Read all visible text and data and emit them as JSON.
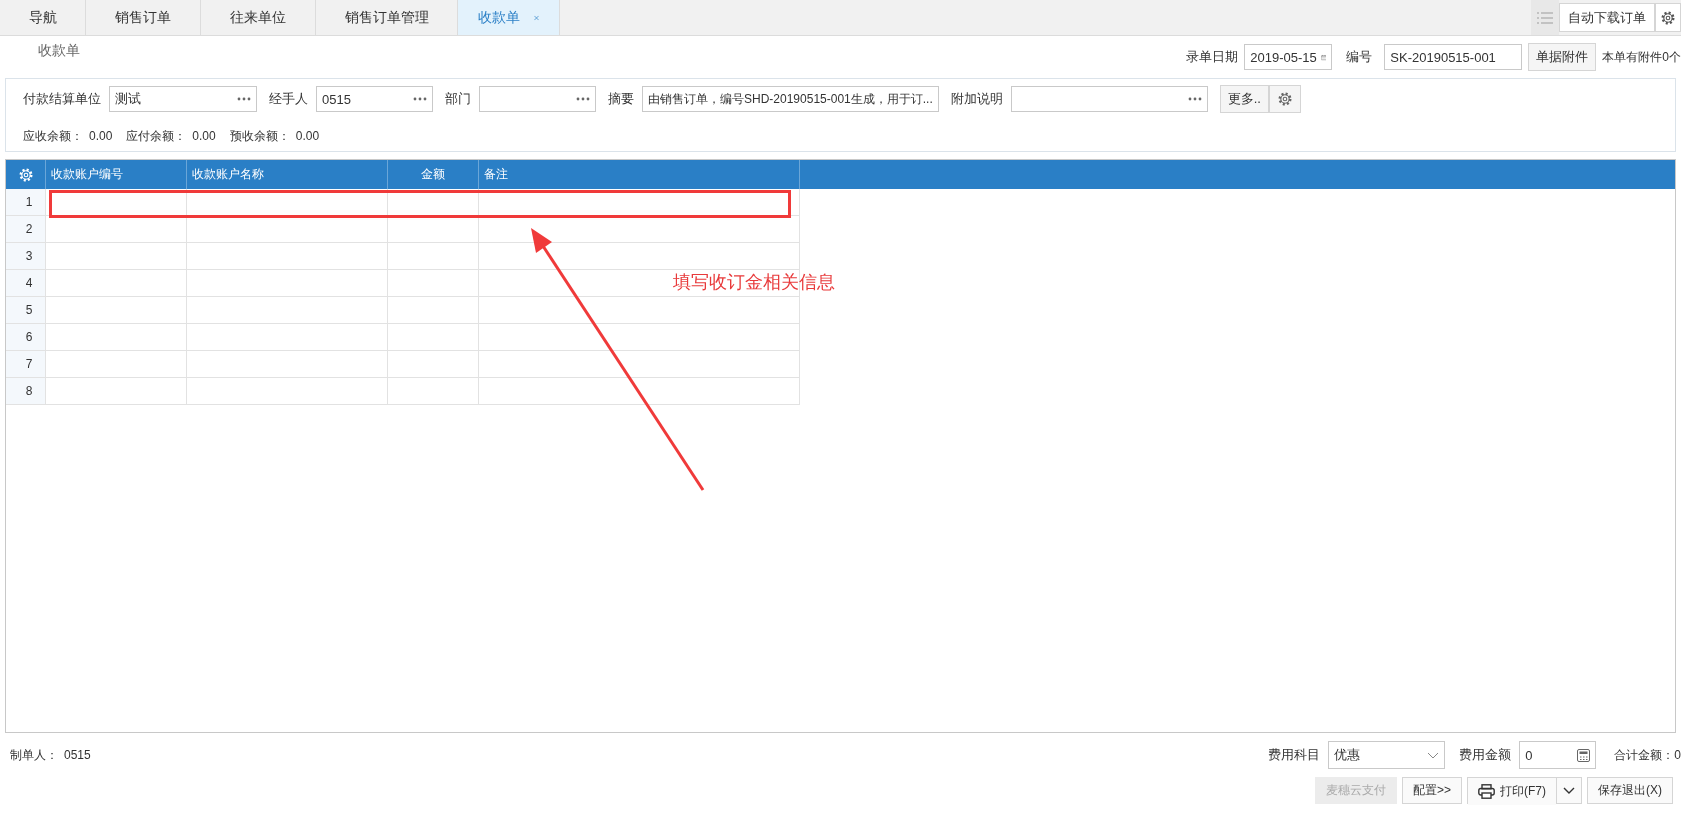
{
  "tabs": [
    {
      "label": "导航",
      "selected": false,
      "closable": false
    },
    {
      "label": "销售订单",
      "selected": false,
      "closable": false
    },
    {
      "label": "往来单位",
      "selected": false,
      "closable": false
    },
    {
      "label": "销售订单管理",
      "selected": false,
      "closable": false
    },
    {
      "label": "收款单",
      "selected": true,
      "closable": true
    }
  ],
  "toolbar": {
    "download_button": "自动下载订单"
  },
  "page_title": "收款单",
  "header": {
    "date_label": "录单日期",
    "date_value": "2019-05-15",
    "number_label": "编号",
    "number_value": "SK-20190515-001",
    "attach_button": "单据附件",
    "attach_note": "本单有附件0个"
  },
  "form": {
    "fields": [
      {
        "label": "付款结算单位",
        "value": "测试",
        "kind": "picker"
      },
      {
        "label": "经手人",
        "value": "0515",
        "kind": "picker"
      },
      {
        "label": "部门",
        "kind": "picker"
      },
      {
        "label": "摘要",
        "value": "由销售订单，编号SHD-20190515-001生成，用于订...",
        "kind": "text"
      },
      {
        "label": "附加说明",
        "kind": "picker"
      }
    ],
    "more_button": "更多..",
    "balances": [
      {
        "label": "应收余额：",
        "value": "0.00"
      },
      {
        "label": "应付余额：",
        "value": "0.00"
      },
      {
        "label": "预收余额：",
        "value": "0.00"
      }
    ]
  },
  "grid": {
    "columns": [
      {
        "label": "收款账户编号",
        "centered": false
      },
      {
        "label": "收款账户名称",
        "centered": false
      },
      {
        "label": "金额",
        "centered": true
      },
      {
        "label": "备注",
        "centered": false
      }
    ],
    "rows": [
      "1",
      "2",
      "3",
      "4",
      "5",
      "6",
      "7",
      "8"
    ]
  },
  "annotation": {
    "text": "填写收订金相关信息"
  },
  "footer": {
    "creator_label": "制单人：",
    "creator": "0515",
    "fee_subject_label": "费用科目",
    "fee_subject": "优惠",
    "fee_amount_label": "费用金额",
    "fee_amount": "0",
    "total_label": "合计金额：",
    "total": "0",
    "buttons": [
      {
        "label": "麦穗云支付",
        "kind": "plain",
        "disabled": true
      },
      {
        "label": "配置>>",
        "kind": "plain",
        "disabled": false
      },
      {
        "label": "打印(F7)",
        "kind": "split",
        "disabled": false
      },
      {
        "label": "保存退出(X)",
        "kind": "plain",
        "disabled": false
      }
    ]
  }
}
